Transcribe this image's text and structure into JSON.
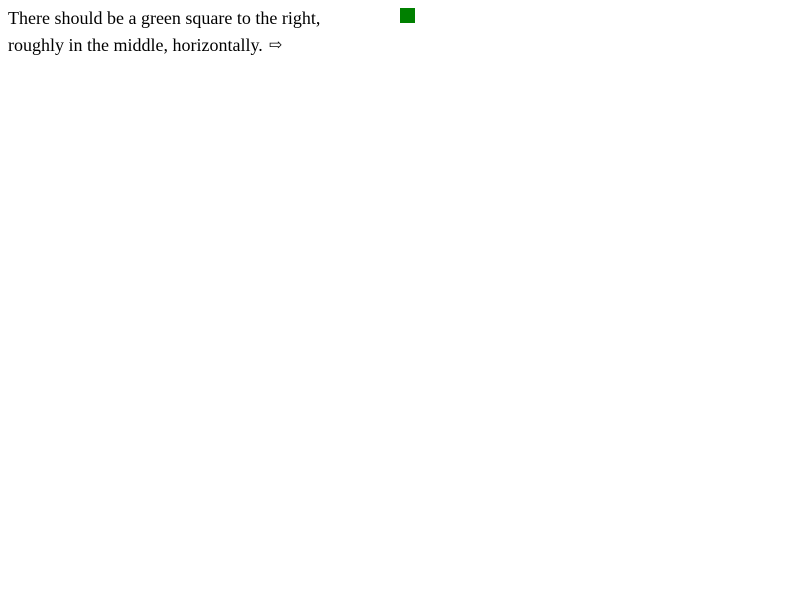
{
  "instruction": {
    "line1": "There should be a green square to the right,",
    "line2": "roughly in the middle, horizontally.",
    "arrow_icon": "right-arrow-icon",
    "arrow_glyph": "⇨"
  },
  "square": {
    "color": "#008000"
  }
}
